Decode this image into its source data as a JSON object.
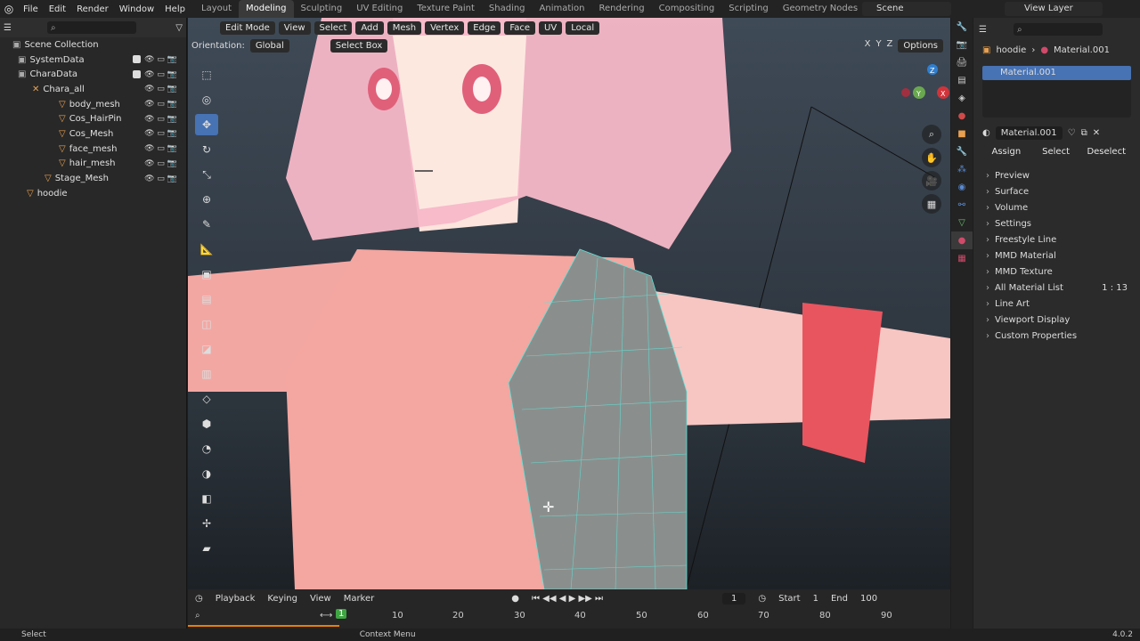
{
  "menu": {
    "file": "File",
    "edit": "Edit",
    "render": "Render",
    "window": "Window",
    "help": "Help"
  },
  "workspaces": [
    "Layout",
    "Modeling",
    "Sculpting",
    "UV Editing",
    "Texture Paint",
    "Shading",
    "Animation",
    "Rendering",
    "Compositing",
    "Scripting",
    "Geometry Nodes"
  ],
  "active_workspace": "Modeling",
  "scene": "Scene",
  "view_layer": "View Layer",
  "outliner": {
    "root": "Scene Collection",
    "rows": [
      {
        "label": "SystemData",
        "indent": 1
      },
      {
        "label": "CharaData",
        "indent": 1
      },
      {
        "label": "Chara_all",
        "indent": 2
      },
      {
        "label": "body_mesh",
        "indent": 3
      },
      {
        "label": "Cos_HairPin",
        "indent": 3
      },
      {
        "label": "Cos_Mesh",
        "indent": 3
      },
      {
        "label": "face_mesh",
        "indent": 3
      },
      {
        "label": "hair_mesh",
        "indent": 3
      },
      {
        "label": "Stage_Mesh",
        "indent": 2
      },
      {
        "label": "hoodie",
        "indent": 1
      }
    ]
  },
  "viewport": {
    "mode": "Edit Mode",
    "menus": [
      "View",
      "Select",
      "Add",
      "Mesh",
      "Vertex",
      "Edge",
      "Face",
      "UV"
    ],
    "transform": "Local",
    "orientation_label": "Orientation:",
    "orientation": "Global",
    "select_tool": "Select Box",
    "options": "Options",
    "axes": [
      "X",
      "Y",
      "Z"
    ]
  },
  "properties": {
    "breadcrumb_object": "hoodie",
    "breadcrumb_material": "Material.001",
    "slot": "Material.001",
    "material_name": "Material.001",
    "assign": "Assign",
    "select": "Select",
    "deselect": "Deselect",
    "panels": [
      "Preview",
      "Surface",
      "Volume",
      "Settings",
      "Freestyle Line",
      "MMD Material",
      "MMD Texture",
      "All Material List",
      "Line Art",
      "Viewport Display",
      "Custom Properties"
    ],
    "all_material_count": "1    : 13"
  },
  "timeline": {
    "playback": "Playback",
    "keying": "Keying",
    "view": "View",
    "marker": "Marker",
    "current": "1",
    "start_label": "Start",
    "start": "1",
    "end_label": "End",
    "end": "100",
    "ticks": [
      "10",
      "20",
      "30",
      "40",
      "50",
      "60",
      "70",
      "80",
      "90"
    ],
    "frame_marker": "1"
  },
  "status": {
    "left": "Select",
    "center": "Context Menu",
    "version": "4.0.2"
  }
}
